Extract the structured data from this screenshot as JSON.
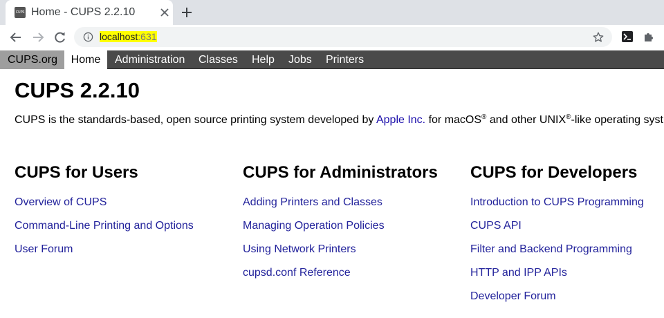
{
  "browser": {
    "tab_title": "Home - CUPS 2.2.10",
    "favicon_text": "CUPS",
    "url_host": "localhost",
    "url_port": ":631",
    "icons": [
      "back-arrow-icon",
      "forward-arrow-icon",
      "reload-icon",
      "info-icon",
      "star-icon",
      "terminal-icon",
      "puzzle-icon",
      "close-icon",
      "plus-icon"
    ]
  },
  "nav": {
    "cups_org": "CUPS.org",
    "home": "Home",
    "administration": "Administration",
    "classes": "Classes",
    "help": "Help",
    "jobs": "Jobs",
    "printers": "Printers"
  },
  "page": {
    "title": "CUPS 2.2.10",
    "intro_prefix": "CUPS is the standards-based, open source printing system developed by ",
    "intro_link": "Apple Inc.",
    "intro_mid": " for macOS",
    "intro_reg1": "®",
    "intro_mid2": " and other UNIX",
    "intro_reg2": "®",
    "intro_suffix": "-like operating syst"
  },
  "columns": {
    "users": {
      "heading": "CUPS for Users",
      "links": [
        "Overview of CUPS",
        "Command-Line Printing and Options",
        "User Forum"
      ]
    },
    "admins": {
      "heading": "CUPS for Administrators",
      "links": [
        "Adding Printers and Classes",
        "Managing Operation Policies",
        "Using Network Printers",
        "cupsd.conf Reference"
      ]
    },
    "developers": {
      "heading": "CUPS for Developers",
      "links": [
        "Introduction to CUPS Programming",
        "CUPS API",
        "Filter and Backend Programming",
        "HTTP and IPP APIs",
        "Developer Forum"
      ]
    }
  },
  "colors": {
    "nav_bg": "#4a4a4a",
    "link": "#22229b",
    "url_highlight": "#ffff00"
  }
}
